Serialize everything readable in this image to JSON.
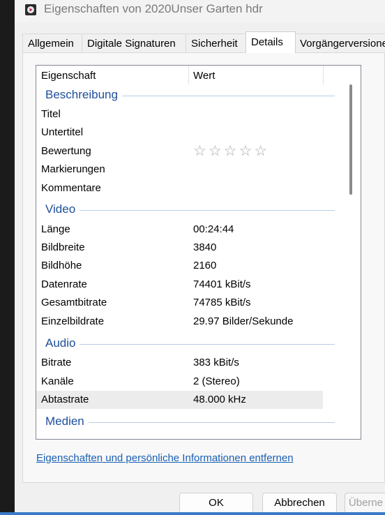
{
  "window": {
    "title": "Eigenschaften von 2020Unser Garten hdr"
  },
  "tabs": [
    {
      "label": "Allgemein",
      "active": false
    },
    {
      "label": "Digitale Signaturen",
      "active": false
    },
    {
      "label": "Sicherheit",
      "active": false
    },
    {
      "label": "Details",
      "active": true
    },
    {
      "label": "Vorgängerversione",
      "active": false
    }
  ],
  "list": {
    "header": {
      "property": "Eigenschaft",
      "value": "Wert"
    },
    "groups": {
      "beschreibung": {
        "title": "Beschreibung",
        "rows": [
          {
            "property": "Titel",
            "value": ""
          },
          {
            "property": "Untertitel",
            "value": ""
          },
          {
            "property": "Bewertung",
            "value": "",
            "stars": "☆☆☆☆☆",
            "rating": 0
          },
          {
            "property": "Markierungen",
            "value": ""
          },
          {
            "property": "Kommentare",
            "value": ""
          }
        ]
      },
      "video": {
        "title": "Video",
        "rows": [
          {
            "property": "Länge",
            "value": "00:24:44"
          },
          {
            "property": "Bildbreite",
            "value": "3840"
          },
          {
            "property": "Bildhöhe",
            "value": "2160"
          },
          {
            "property": "Datenrate",
            "value": "74401 kBit/s"
          },
          {
            "property": "Gesamtbitrate",
            "value": "74785 kBit/s"
          },
          {
            "property": "Einzelbildrate",
            "value": "29.97 Bilder/Sekunde"
          }
        ]
      },
      "audio": {
        "title": "Audio",
        "rows": [
          {
            "property": "Bitrate",
            "value": "383 kBit/s"
          },
          {
            "property": "Kanäle",
            "value": "2 (Stereo)"
          },
          {
            "property": "Abtastrate",
            "value": "48.000 kHz",
            "selected": true
          }
        ]
      },
      "medien": {
        "title": "Medien"
      }
    }
  },
  "remove_link": "Eigenschaften und persönliche Informationen entfernen",
  "buttons": {
    "ok": "OK",
    "cancel": "Abbrechen",
    "apply": "Überne"
  },
  "colors": {
    "group_title": "#1e4e9c",
    "link": "#1a5fb4",
    "selection": "#ececec"
  }
}
